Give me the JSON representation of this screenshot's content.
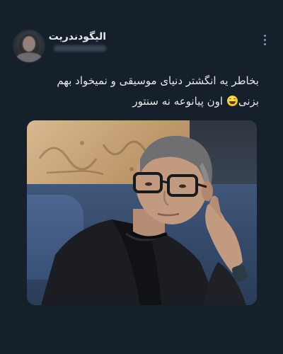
{
  "tweet": {
    "display_name": "الیگودندریت",
    "more_icon": "more-vertical-icon",
    "text_line_1": "بخاطر یه انگشتر دنیای موسیقی و نمیخواد بهم",
    "text_line_2_start": "بزنی",
    "text_line_2_end": " اون پیانوعه نه سنتور",
    "emoji": "grinning-sweat-emoji",
    "media": {
      "description_icon": "photo",
      "colors": {
        "background": "#15202b",
        "text": "#e7e9ea",
        "muted": "#8b98a5"
      }
    }
  }
}
